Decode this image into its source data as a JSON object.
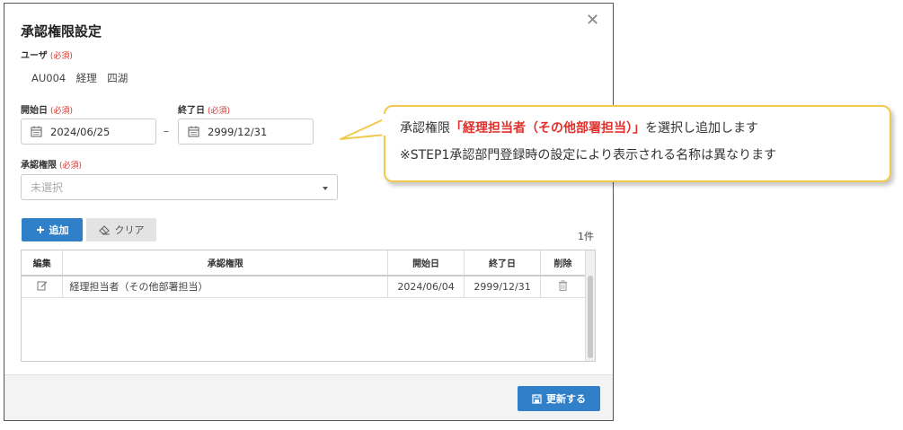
{
  "dialog": {
    "title": "承認権限設定",
    "close_glyph": "✕"
  },
  "user": {
    "label": "ユーザ",
    "required": "(必須)",
    "value": "AU004　経理　四湖"
  },
  "start_date": {
    "label": "開始日",
    "required": "(必須)",
    "value": "2024/06/25"
  },
  "range_dash": "–",
  "end_date": {
    "label": "終了日",
    "required": "(必須)",
    "value": "2999/12/31"
  },
  "approval": {
    "label": "承認権限",
    "required": "(必須)",
    "placeholder": "未選択"
  },
  "toolbar": {
    "add_label": "追加",
    "clear_label": "クリア",
    "count": "1件"
  },
  "table": {
    "headers": {
      "edit": "編集",
      "authority": "承認権限",
      "start": "開始日",
      "end": "終了日",
      "delete": "削除"
    },
    "rows": [
      {
        "authority": "経理担当者（その他部署担当）",
        "start": "2024/06/04",
        "end": "2999/12/31"
      }
    ]
  },
  "footer": {
    "update_label": "更新する"
  },
  "callout": {
    "prefix": "承認権限",
    "highlight": "「経理担当者（その他部署担当）」",
    "suffix": "を選択し追加します",
    "note": "※STEP1承認部門登録時の設定により表示される名称は異なります"
  },
  "colors": {
    "primary_button": "#2f80c9",
    "required_text": "#d9342b",
    "callout_border": "#f2c94c",
    "callout_highlight": "#e0312c"
  },
  "icons": {
    "calendar": "calendar-icon",
    "plus": "plus-icon",
    "eraser": "eraser-icon",
    "edit": "edit-icon",
    "trash": "trash-icon",
    "save": "save-icon",
    "close": "close-icon",
    "dropdown": "chevron-down-icon"
  }
}
